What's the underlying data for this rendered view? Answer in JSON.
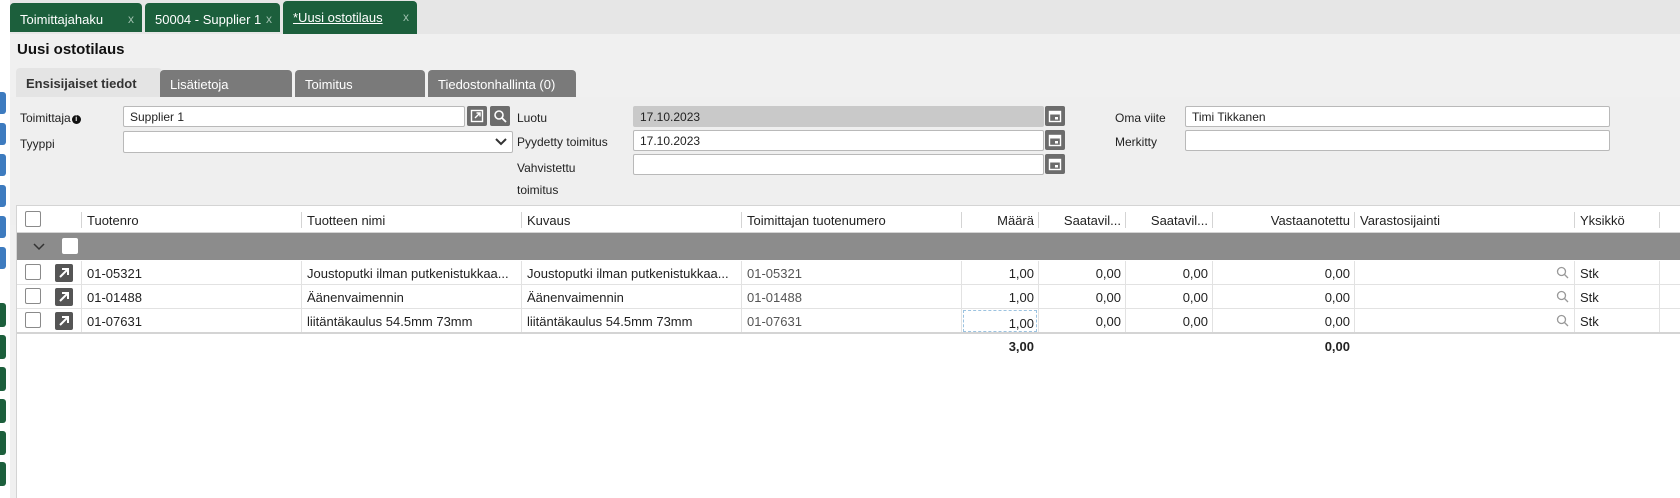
{
  "tabs": [
    {
      "label": "Toimittajahaku",
      "close": "x"
    },
    {
      "label": "50004 - Supplier 1",
      "close": "x"
    },
    {
      "label": "*Uusi ostotilaus",
      "close": "x"
    }
  ],
  "page_title": "Uusi ostotilaus",
  "subtabs": [
    "Ensisijaiset tiedot",
    "Lisätietoja",
    "Toimitus",
    "Tiedostonhallinta (0)"
  ],
  "form": {
    "supplier_label": "Toimittaja",
    "supplier_value": "Supplier 1",
    "type_label": "Tyyppi",
    "type_value": "",
    "created_label": "Luotu",
    "created_value": "17.10.2023",
    "requested_label": "Pyydetty toimitus",
    "requested_value": "17.10.2023",
    "confirmed_label_1": "Vahvistettu",
    "confirmed_label_2": "toimitus",
    "confirmed_value": "",
    "own_ref_label": "Oma viite",
    "own_ref_value": "Timi Tikkanen",
    "marked_label": "Merkitty",
    "marked_value": ""
  },
  "grid": {
    "columns": [
      "Tuotenro",
      "Tuotteen nimi",
      "Kuvaus",
      "Toimittajan tuotenumero",
      "Määrä",
      "Saatavil...",
      "Saatavil...",
      "Vastaanotettu",
      "Varastosijainti",
      "Yksikkö"
    ],
    "rows": [
      {
        "code": "01-05321",
        "name": "Joustoputki ilman putkenistukkaa...",
        "desc": "Joustoputki ilman putkenistukkaa...",
        "supplier_code": "01-05321",
        "qty": "1,00",
        "avail1": "0,00",
        "avail2": "0,00",
        "received": "0,00",
        "location": "",
        "unit": "Stk"
      },
      {
        "code": "01-01488",
        "name": "Äänenvaimennin",
        "desc": "Äänenvaimennin",
        "supplier_code": "01-01488",
        "qty": "1,00",
        "avail1": "0,00",
        "avail2": "0,00",
        "received": "0,00",
        "location": "",
        "unit": "Stk"
      },
      {
        "code": "01-07631",
        "name": "liitäntäkaulus 54.5mm 73mm",
        "desc": "liitäntäkaulus 54.5mm 73mm",
        "supplier_code": "01-07631",
        "qty": "1,00",
        "avail1": "0,00",
        "avail2": "0,00",
        "received": "0,00",
        "location": "",
        "unit": "Stk"
      }
    ],
    "totals": {
      "qty": "3,00",
      "received": "0,00"
    }
  },
  "icons": {
    "open": "open-external-icon",
    "search": "search-icon",
    "calendar": "calendar-icon",
    "dropdown": "chevron-down-icon",
    "info": "info-icon"
  },
  "colors": {
    "tab_green": "#1c5f3c",
    "group_row": "#8c8c8c",
    "accent_blue": "#3d7bbf"
  }
}
